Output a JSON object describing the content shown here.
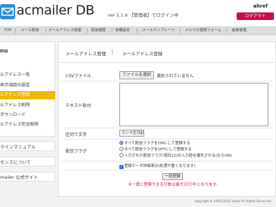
{
  "header": {
    "logo_text": "acmailer DB",
    "version_text": "ver 1.1.6 【管理者】でログイン中",
    "user_name": "ahref",
    "logout_label": "ログアウト"
  },
  "nav": {
    "items": [
      "TOP",
      "メール配信",
      "メールアドレス管理",
      "配信履歴",
      "各種設定",
      "メールテンプレート",
      "メルマガ登録フォーム",
      "画像管理"
    ]
  },
  "sidebar": {
    "title": "nu",
    "items": [
      {
        "label": "ルアドレス一覧"
      },
      {
        "label": "表示項目の設定"
      },
      {
        "label": "ルアドレス登録"
      },
      {
        "label": "ルアドレス削除"
      },
      {
        "label": "ダウンロード"
      },
      {
        "label": "ルアドレス完全削除"
      }
    ],
    "links": [
      "ラインマニュアル",
      "センスについて",
      "mailer 公式サイト"
    ]
  },
  "breadcrumb": [
    "メールアドレス管理",
    "メールアドレス登録"
  ],
  "form": {
    "csv_label": "CSVファイル",
    "file_button": "ファイルを選択",
    "file_status": "選択されていません",
    "text_label": "テキスト貼付",
    "textarea_value": "",
    "delimiter_label": "区切り文字",
    "delimiter_value": "カンマ区切り",
    "flag_label": "配信フラグ",
    "flag_options": [
      "すべて配信フラグをONにして登録する",
      "すべて配信フラグをOFFにして登録する",
      "入力された配信フラグ(項目12)の入力値を優先させる(ならON)"
    ],
    "flag_selected_index": 0,
    "duplicate_check_label": "登録データ詳細表示(処理が重くなります)",
    "duplicate_check_checked": true,
    "submit_label": "一括登録",
    "note": "※一度に登録できる行数は最大10万件となります。"
  },
  "footer": {
    "copyright": "copyright © 2003-2015 ahref All Rights Reserved."
  },
  "colors": {
    "accent": "#f0b800",
    "logout": "#cc0a53",
    "note": "#e0006a"
  }
}
